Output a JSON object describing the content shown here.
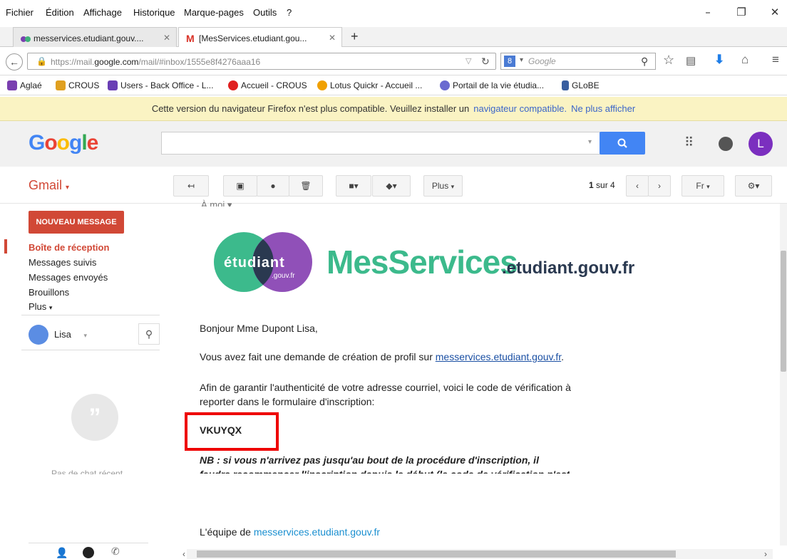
{
  "menubar": {
    "items": [
      "Fichier",
      "Édition",
      "Affichage",
      "Historique",
      "Marque-pages",
      "Outils",
      "?"
    ]
  },
  "tabs": [
    {
      "label": "messervices.etudiant.gouv....",
      "icon": "purple-green-dots-icon"
    },
    {
      "label": "[MesServices.etudiant.gou...",
      "icon": "gmail-icon"
    }
  ],
  "navbar": {
    "url_prefix": "https://mail.",
    "url_domain": "google.com",
    "url_path": "/mail/#inbox/1555e8f4276aaa16",
    "search_placeholder": "Google"
  },
  "bookmarks": [
    {
      "label": "Aglaé",
      "color": "#7a3fb0"
    },
    {
      "label": "CROUS",
      "color": "#e0a020"
    },
    {
      "label": "Users - Back Office - L...",
      "color": "#6a3fb5"
    },
    {
      "label": "Accueil - CROUS",
      "color": "#e02020"
    },
    {
      "label": "Lotus Quickr - Accueil ...",
      "color": "#f0a000"
    },
    {
      "label": "Portail de la vie étudia...",
      "color": "#6a6ad0"
    },
    {
      "label": "GLoBE",
      "color": "#3a5fa0"
    }
  ],
  "notice": {
    "text": "Cette version du navigateur Firefox n'est plus compatible. Veuillez installer un",
    "link": "navigateur compatible.",
    "dismiss": "Ne plus afficher"
  },
  "google": {
    "logo": "Google",
    "avatar_letter": "L"
  },
  "gmail": {
    "label": "Gmail",
    "more_label": "Plus",
    "pager_current": "1",
    "pager_text": "sur 4",
    "lang": "Fr"
  },
  "sidebar": {
    "compose": "NOUVEAU MESSAGE",
    "items": [
      "Boîte de réception",
      "Messages suivis",
      "Messages envoyés",
      "Brouillons",
      "Plus"
    ],
    "user": "Lisa",
    "hangouts_hint": "Pas de chat récent"
  },
  "email": {
    "to_me": "À moi",
    "logo_word": "étudiant",
    "logo_sub": ".gouv.fr",
    "logo_brand": "MesServices",
    "logo_domain": ".etudiant.gouv.fr",
    "greeting": "Bonjour Mme Dupont Lisa,",
    "line1_prefix": "Vous avez fait une demande de création de profil sur ",
    "line1_link": "messervices.etudiant.gouv.fr",
    "line1_suffix": ".",
    "line2": "Afin de garantir l'authenticité de votre adresse courriel, voici le code de vérification à",
    "line3": "reporter dans le formulaire d'inscription:",
    "code": "VKUYQX",
    "nb1": "NB : si vous n'arrivez pas jusqu'au bout de la procédure d'inscription, il",
    "nb2": "faudra recommencer l'inscription depuis le début (le code de vérification n'est",
    "signoff_prefix": "L'équipe de ",
    "signoff_link": "messervices.etudiant.gouv.fr"
  }
}
